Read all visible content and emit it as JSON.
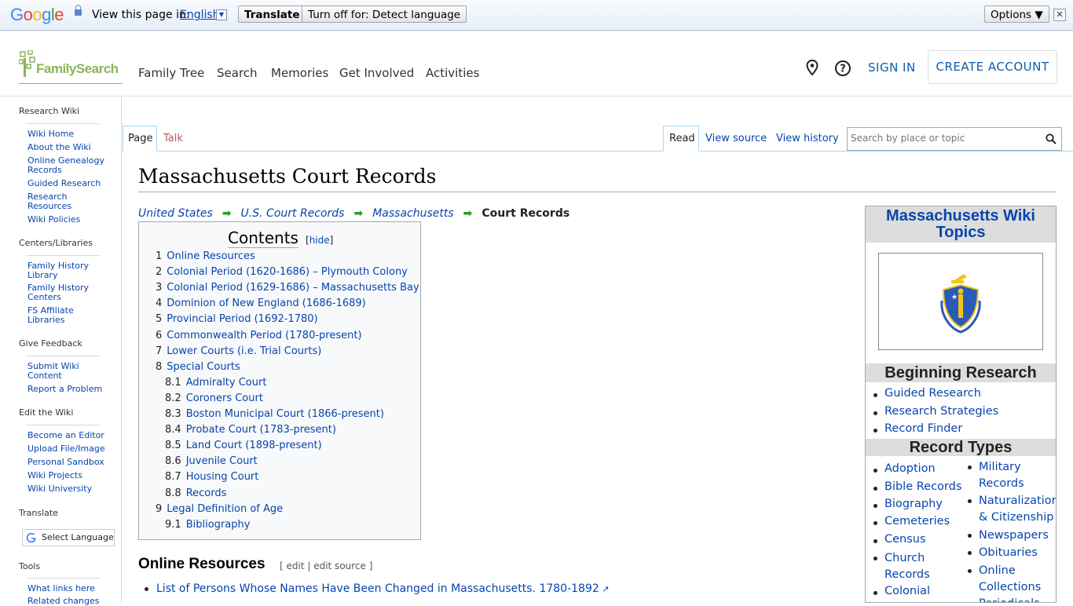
{
  "translate_bar": {
    "logo": "Google",
    "prompt": "View this page in:",
    "language": "English",
    "translate_button": "Translate",
    "turn_off_button": "Turn off for: Detect language",
    "options_button": "Options ▼",
    "close": "✕"
  },
  "header": {
    "logo_text": "FamilySearch",
    "nav": [
      "Family Tree",
      "Search",
      "Memories",
      "Get Involved",
      "Activities"
    ],
    "sign_in": "SIGN IN",
    "create_account": "CREATE ACCOUNT"
  },
  "sidebar": {
    "sections": [
      {
        "heading": "Research Wiki",
        "links": [
          "Wiki Home",
          "About the Wiki",
          "Online Genealogy Records",
          "Guided Research",
          "Research Resources",
          "Wiki Policies"
        ]
      },
      {
        "heading": "Centers/Libraries",
        "links": [
          "Family History Library",
          "Family History Centers",
          "FS Affiliate Libraries"
        ]
      },
      {
        "heading": "Give Feedback",
        "links": [
          "Submit Wiki Content",
          "Report a Problem"
        ]
      },
      {
        "heading": "Edit the Wiki",
        "links": [
          "Become an Editor",
          "Upload File/Image",
          "Personal Sandbox",
          "Wiki Projects",
          "Wiki University"
        ]
      },
      {
        "heading": "Translate",
        "links": []
      },
      {
        "heading": "Tools",
        "links": [
          "What links here",
          "Related changes"
        ]
      }
    ],
    "select_language": "Select Language"
  },
  "tabs": {
    "page": "Page",
    "talk": "Talk",
    "read": "Read",
    "view_source": "View source",
    "view_history": "View history",
    "search_placeholder": "Search by place or topic"
  },
  "content": {
    "title": "Massachusetts Court Records",
    "breadcrumbs": [
      "United States",
      "U.S. Court Records",
      "Massachusetts",
      "Court Records"
    ],
    "toc": {
      "heading": "Contents",
      "hide": "hide",
      "items": [
        {
          "num": "1",
          "text": "Online Resources",
          "level": 1
        },
        {
          "num": "2",
          "text": "Colonial Period (1620-1686) – Plymouth Colony",
          "level": 1
        },
        {
          "num": "3",
          "text": "Colonial Period (1629-1686) – Massachusetts Bay",
          "level": 1
        },
        {
          "num": "4",
          "text": "Dominion of New England (1686-1689)",
          "level": 1
        },
        {
          "num": "5",
          "text": "Provincial Period (1692-1780)",
          "level": 1
        },
        {
          "num": "6",
          "text": "Commonwealth Period (1780-present)",
          "level": 1
        },
        {
          "num": "7",
          "text": "Lower Courts (i.e. Trial Courts)",
          "level": 1
        },
        {
          "num": "8",
          "text": "Special Courts",
          "level": 1
        },
        {
          "num": "8.1",
          "text": "Admiralty Court",
          "level": 2
        },
        {
          "num": "8.2",
          "text": "Coroners Court",
          "level": 2
        },
        {
          "num": "8.3",
          "text": "Boston Municipal Court (1866-present)",
          "level": 2
        },
        {
          "num": "8.4",
          "text": "Probate Court (1783-present)",
          "level": 2
        },
        {
          "num": "8.5",
          "text": "Land Court (1898-present)",
          "level": 2
        },
        {
          "num": "8.6",
          "text": "Juvenile Court",
          "level": 2
        },
        {
          "num": "8.7",
          "text": "Housing Court",
          "level": 2
        },
        {
          "num": "8.8",
          "text": "Records",
          "level": 2
        },
        {
          "num": "9",
          "text": "Legal Definition of Age",
          "level": 1
        },
        {
          "num": "9.1",
          "text": "Bibliography",
          "level": 2
        }
      ]
    },
    "section_heading": "Online Resources",
    "section_edit": "[ edit | edit source ]",
    "first_item": "List of Persons Whose Names Have Been Changed in Massachusetts. 1780-1892"
  },
  "infobox": {
    "title": "Massachusetts Wiki Topics",
    "beginning_heading": "Beginning Research",
    "beginning_links": [
      "Guided Research",
      "Research Strategies",
      "Record Finder"
    ],
    "record_types_heading": "Record Types",
    "record_types_left": [
      "Adoption",
      "Bible Records",
      "Biography",
      "Cemeteries",
      "Census",
      "Church Records",
      "Colonial"
    ],
    "record_types_right": [
      "Military Records",
      "Naturalization & Citizenship",
      "Newspapers",
      "Obituaries",
      "Online Collections",
      "Periodicals"
    ]
  }
}
